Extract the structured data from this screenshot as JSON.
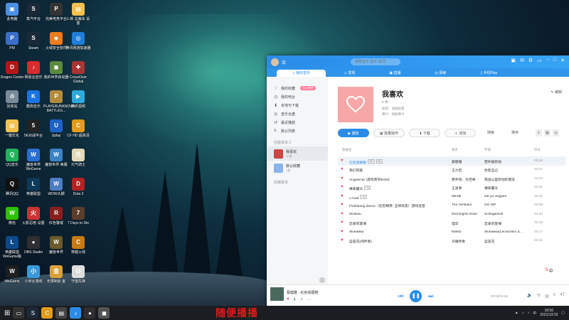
{
  "desktop_icons": [
    {
      "id": "pc",
      "label": "此电脑",
      "color": "#4a90e2",
      "glyph": "▣"
    },
    {
      "id": "steam",
      "label": "蒸汽平台",
      "color": "#1b2838",
      "glyph": "S"
    },
    {
      "id": "pubg",
      "label": "完美电竞平台",
      "color": "#333",
      "glyph": "P"
    },
    {
      "id": "folder1",
      "label": "1-新 总裁车 设置",
      "color": "#f2c14e",
      "glyph": "▤"
    },
    {
      "id": "pm",
      "label": "PM",
      "color": "#3a6ec9",
      "glyph": "P"
    },
    {
      "id": "steam2",
      "label": "Steam",
      "color": "#1b2838",
      "glyph": "S"
    },
    {
      "id": "huorong",
      "label": "火绒安全软件",
      "color": "#f07b1c",
      "glyph": "◆"
    },
    {
      "id": "wallpaper",
      "label": "腾讯网游加速器",
      "color": "#1e7ed8",
      "glyph": "◎"
    },
    {
      "id": "dragon",
      "label": "Dragon Center",
      "color": "#b01818",
      "glyph": "D"
    },
    {
      "id": "netease",
      "label": "网易云音乐",
      "color": "#d72d2d",
      "glyph": "♪"
    },
    {
      "id": "yy",
      "label": "我的世界启动器",
      "color": "#5c8a3e",
      "glyph": "◼"
    },
    {
      "id": "cross",
      "label": "CrossOver Global",
      "color": "#a33",
      "glyph": "✚"
    },
    {
      "id": "recycle",
      "label": "回收站",
      "color": "#7a8a99",
      "glyph": "♻"
    },
    {
      "id": "kugou",
      "label": "酷狗音乐",
      "color": "#1a74e0",
      "glyph": "K"
    },
    {
      "id": "pubg2",
      "label": "PLAYERUNKNOWN BATTLEG...",
      "color": "#b48b3c",
      "glyph": "P"
    },
    {
      "id": "tencent",
      "label": "腾讯视频",
      "color": "#2eaadc",
      "glyph": "▶"
    },
    {
      "id": "folder2",
      "label": "一键优化",
      "color": "#f2c14e",
      "glyph": "▤"
    },
    {
      "id": "game5",
      "label": "5E对战平台",
      "color": "#222",
      "glyph": "5"
    },
    {
      "id": "uplay",
      "label": "Uplay",
      "color": "#1e62c8",
      "glyph": "U"
    },
    {
      "id": "cfhd",
      "label": "CF HD 超高清",
      "color": "#e29b1a",
      "glyph": "C"
    },
    {
      "id": "qqmusic",
      "label": "QQ音乐",
      "color": "#22b35a",
      "glyph": "Q"
    },
    {
      "id": "wegame",
      "label": "魔兽世界 WeGame",
      "color": "#2a6fd1",
      "glyph": "W"
    },
    {
      "id": "wow2",
      "label": "魔兽世界 美服",
      "color": "#3b82c4",
      "glyph": "W"
    },
    {
      "id": "yuanqi",
      "label": "元气骑士",
      "color": "#e3d9b8",
      "glyph": "元"
    },
    {
      "id": "qq",
      "label": "腾讯QQ",
      "color": "#111",
      "glyph": "Q"
    },
    {
      "id": "lol",
      "label": "英雄联盟",
      "color": "#0e3b5a",
      "glyph": "L"
    },
    {
      "id": "wowx",
      "label": "WOW大脚",
      "color": "#4d7dc2",
      "glyph": "W"
    },
    {
      "id": "dota2",
      "label": "Dota 2",
      "color": "#b22222",
      "glyph": "D"
    },
    {
      "id": "wechat",
      "label": "微信",
      "color": "#2dc100",
      "glyph": "W"
    },
    {
      "id": "yy2",
      "label": "火影忍者 设置",
      "color": "#c33",
      "glyph": "火"
    },
    {
      "id": "game3",
      "label": "红色警戒",
      "color": "#8c1d1d",
      "glyph": "R"
    },
    {
      "id": "days",
      "label": "7 Days to Die",
      "color": "#5b3d2b",
      "glyph": "7"
    },
    {
      "id": "league2",
      "label": "英雄联盟 WeGame版",
      "color": "#0c4a8c",
      "glyph": "L"
    },
    {
      "id": "obs",
      "label": "OBS Studio",
      "color": "#302e31",
      "glyph": "●"
    },
    {
      "id": "wowcn",
      "label": "魔兽世界",
      "color": "#6b5a2b",
      "glyph": "W"
    },
    {
      "id": "cfhd2",
      "label": "穿越火线",
      "color": "#c77a16",
      "glyph": "C"
    },
    {
      "id": "wegame2",
      "label": "WeGame",
      "color": "#1f1f1f",
      "glyph": "W"
    },
    {
      "id": "game4",
      "label": "小米云游戏",
      "color": "#3a9ad9",
      "glyph": "小"
    },
    {
      "id": "game6",
      "label": "无限制武 金",
      "color": "#d9a03a",
      "glyph": "金"
    },
    {
      "id": "game7",
      "label": "守望先锋",
      "color": "#ddd",
      "glyph": "O"
    }
  ],
  "window": {
    "user": "余",
    "search_placeholder": "搜索音乐 歌手 歌词",
    "tabs": [
      "我的音乐",
      "发现",
      "直播",
      "探索",
      "手机Play"
    ],
    "sidebar": {
      "items": [
        {
          "icon": "♡",
          "label": "我的收藏",
          "badge": "红心快传"
        },
        {
          "icon": "◷",
          "label": "我的电台",
          "badge": ""
        },
        {
          "icon": "⬇",
          "label": "本地与下载",
          "badge": ""
        },
        {
          "icon": "◎",
          "label": "音乐云盘",
          "badge": ""
        },
        {
          "icon": "↺",
          "label": "最近播放",
          "badge": ""
        },
        {
          "icon": "≡",
          "label": "默认列表",
          "badge": ""
        }
      ],
      "created_header": "创建歌单 2",
      "playlists": [
        {
          "name": "我喜欢",
          "count": "20首",
          "color": "#c44"
        },
        {
          "name": "默认收藏",
          "count": "1首",
          "color": "#8ab4e8"
        }
      ],
      "collected_header": "收藏歌单"
    },
    "playlist": {
      "title": "我喜欢",
      "owner": "余",
      "tag_label": "标签：",
      "tag_value": "添加标签",
      "intro_label": "简介：",
      "intro_value": "添加简介",
      "edit": "编辑"
    },
    "actions": {
      "play_all": "播放",
      "batch": "批量操作",
      "download": "下载",
      "add": "添加",
      "search": "搜索",
      "sort": "排序"
    },
    "columns": {
      "title": "歌曲名",
      "artist": "歌手",
      "album": "专辑",
      "duration": "时长"
    },
    "songs": [
      {
        "title": "红色高跟鞋",
        "tags": [
          "VIP",
          "HQ"
        ],
        "artist": "蔡健雅",
        "album": "若你碰到他",
        "duration": "03:26",
        "hl": true
      },
      {
        "title": "我们的歌",
        "tags": [],
        "artist": "王力宏",
        "album": "改变自己",
        "duration": "04:07",
        "hl": false
      },
      {
        "title": "Angetenar (游戏原声BGM)",
        "tags": [],
        "artist": "要罗顿、付佳男",
        "album": "我送山里和他的朋友",
        "duration": "01:04",
        "hl": false
      },
      {
        "title": "横争霸天",
        "tags": [
          "HQ"
        ],
        "artist": "王喜惠",
        "album": "横争霸天",
        "duration": "03:32",
        "hl": false
      },
      {
        "title": "u mad",
        "tags": [
          "HQ"
        ],
        "artist": "Mino$",
        "album": "eat ya veggies",
        "duration": "02:31",
        "hl": false
      },
      {
        "title": "Flashbang dance（反恐精英: 全球攻势）游戏混音",
        "tags": [],
        "artist": "The Verkkars",
        "album": "GG WP",
        "duration": "03:09",
        "hl": false
      },
      {
        "title": "Moskau",
        "tags": [],
        "artist": "Dschinghis Khan",
        "album": "Schlagerkult",
        "duration": "04:30",
        "hl": false
      },
      {
        "title": "恋爱的旋律",
        "tags": [],
        "artist": "理华",
        "album": "恋爱的旋律",
        "duration": "01:52",
        "hl": false
      },
      {
        "title": "Любимка",
        "tags": [],
        "artist": "Niletto",
        "album": "Любимка(Leruschkin & ...",
        "duration": "03:17",
        "hl": false
      },
      {
        "title": "蓝莲花(纯伴奏)",
        "tags": [],
        "artist": "许巍伴奏",
        "album": "蓝莲花",
        "duration": "03:41",
        "hl": false
      }
    ],
    "player": {
      "now_playing": "蔡健雅 · 红色高跟鞋",
      "time": "00:00/03:26",
      "count": "47"
    }
  },
  "taskbar": {
    "caption": "随便播播",
    "time": "18:56",
    "date": "2021/12/19"
  }
}
